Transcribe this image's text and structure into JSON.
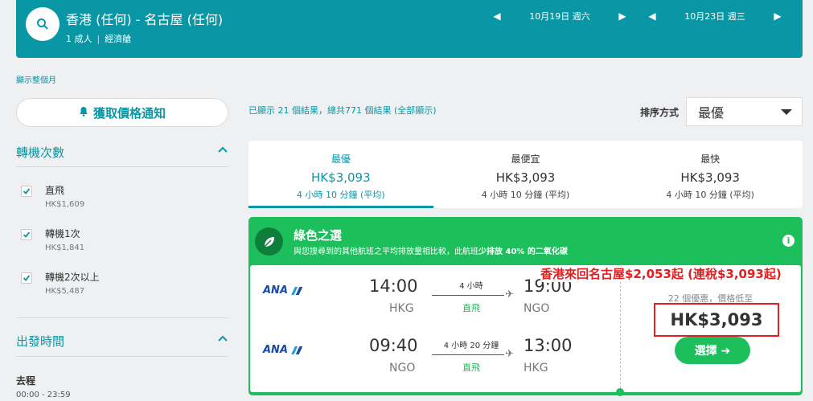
{
  "header": {
    "route": "香港 (任何) - 名古屋 (任何)",
    "passengers": "1 成人",
    "cabin": "經濟艙",
    "depart_date": "10月19日 週六",
    "return_date": "10月23日 週三"
  },
  "sidebar": {
    "month_link": "顯示整個月",
    "alert_button": "獲取價格通知",
    "stops_heading": "轉機次數",
    "stops": [
      {
        "label": "直飛",
        "price": "HK$1,609"
      },
      {
        "label": "轉機1次",
        "price": "HK$1,841"
      },
      {
        "label": "轉機2次以上",
        "price": "HK$5,487"
      }
    ],
    "time_heading": "出發時間",
    "trip_label": "去程",
    "trip_time": "00:00 - 23:59"
  },
  "results": {
    "info": "已顯示 21 個結果，總共771 個結果 (全部顯示)",
    "sort_label": "排序方式",
    "sort_value": "最優"
  },
  "tabs": [
    {
      "name": "最優",
      "price": "HK$3,093",
      "duration": "4 小時 10 分鐘 (平均)"
    },
    {
      "name": "最便宜",
      "price": "HK$3,093",
      "duration": "4 小時 10 分鐘 (平均)"
    },
    {
      "name": "最快",
      "price": "HK$3,093",
      "duration": "4 小時 10 分鐘 (平均)"
    }
  ],
  "green": {
    "title": "綠色之選",
    "desc_prefix": "與您搜尋到的其他航班之平均排放量相比較，此航班",
    "desc_bold": "少排放 40% 的二氧化碳",
    "info": "i"
  },
  "flight": {
    "legs": [
      {
        "airline": "ANA",
        "dep_time": "14:00",
        "dep_code": "HKG",
        "arr_time": "19:00",
        "arr_code": "NGO",
        "duration": "4 小時",
        "stops": "直飛"
      },
      {
        "airline": "ANA",
        "dep_time": "09:40",
        "dep_code": "NGO",
        "arr_time": "13:00",
        "arr_code": "HKG",
        "duration": "4 小時 20 分鐘",
        "stops": "直飛"
      }
    ],
    "price_note": "22 個優惠，價格低至",
    "price": "HK$3,093",
    "select_label": "選擇 ➔"
  },
  "annotation": "香港來回名古屋$2,053起 (連稅$3,093起)",
  "colors": {
    "teal": "#0a97a5",
    "green": "#1dbe5c",
    "red": "#e02020"
  }
}
